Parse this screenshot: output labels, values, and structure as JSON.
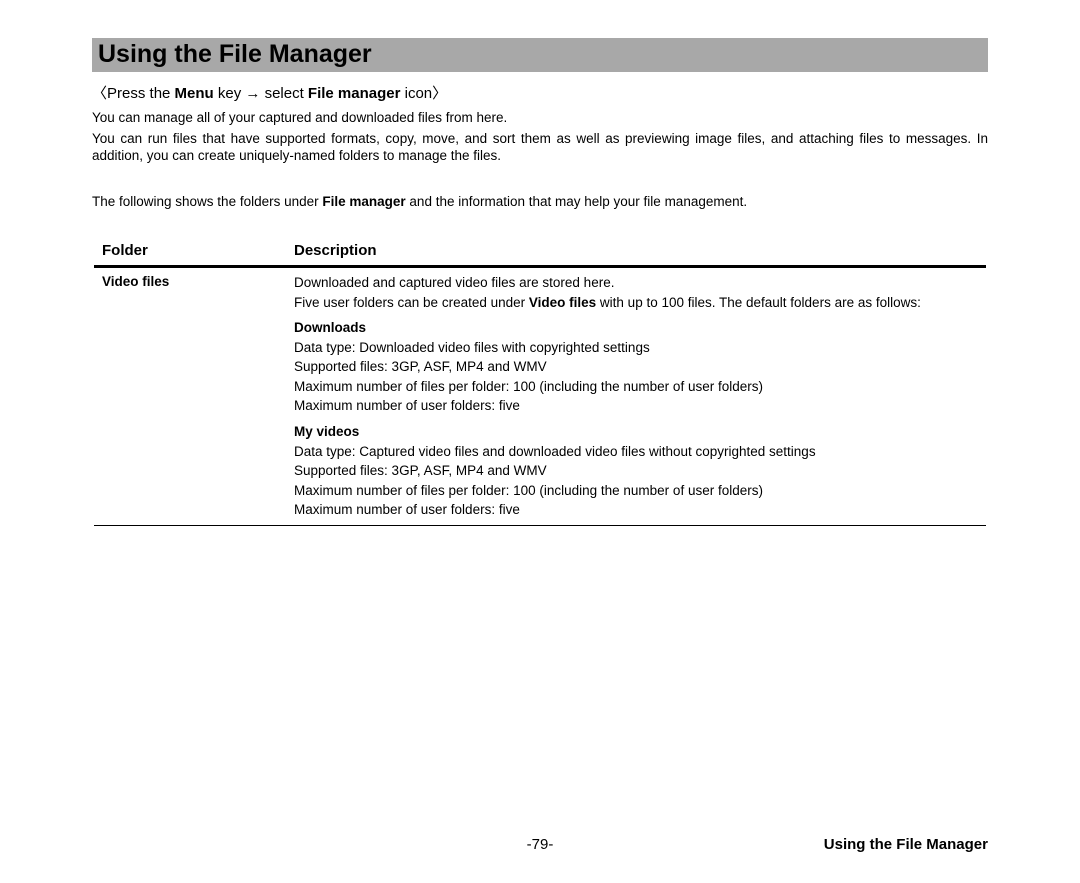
{
  "title": "Using the File Manager",
  "nav": {
    "open": "〈",
    "press": "Press the ",
    "menu": "Menu",
    "key_arrow": " key → select ",
    "fm": "File manager",
    "icon": " icon",
    "close": "〉"
  },
  "intro1": "You can manage all of your captured and downloaded files from here.",
  "intro2": "You can run files that have supported formats, copy, move, and sort them as well as previewing image files, and attaching files to messages. In addition, you can create uniquely-named folders to manage the files.",
  "intro3_a": "The following shows the folders under ",
  "intro3_b": "File manager",
  "intro3_c": " and the information that may help your file management.",
  "table": {
    "header_folder": "Folder",
    "header_desc": "Description",
    "row": {
      "folder": "Video files",
      "lines": [
        {
          "text": "Downloaded and captured video files are stored here."
        },
        {
          "html": "Five user folders can be created under <b>Video files</b> with up to 100 files. The default folders are as follows:"
        },
        {
          "text": "Downloads",
          "bold": true,
          "gap": true
        },
        {
          "text": "Data type: Downloaded video files with copyrighted settings"
        },
        {
          "text": "Supported files: 3GP, ASF, MP4 and WMV"
        },
        {
          "text": "Maximum number of files per folder: 100 (including the number of user folders)"
        },
        {
          "text": "Maximum number of user folders: five"
        },
        {
          "text": "My videos",
          "bold": true,
          "gap": true
        },
        {
          "text": "Data type: Captured video files and downloaded video files without copyrighted settings"
        },
        {
          "text": "Supported files: 3GP, ASF, MP4 and WMV"
        },
        {
          "text": "Maximum number of files per folder: 100 (including the number of user folders)"
        },
        {
          "text": "Maximum number of user folders: five"
        }
      ]
    }
  },
  "footer": {
    "page": "-79-",
    "section": "Using the File Manager"
  }
}
